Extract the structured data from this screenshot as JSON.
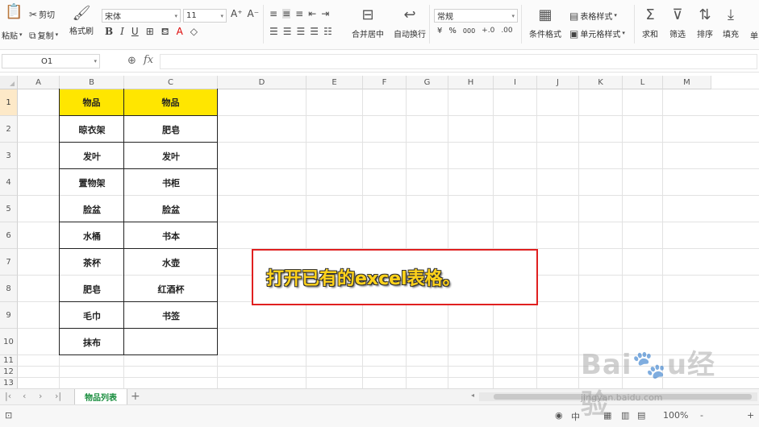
{
  "ribbon": {
    "paste": "粘贴",
    "cut": "剪切",
    "copy": "复制",
    "format_painter": "格式刷",
    "font_name": "宋体",
    "font_size": "11",
    "number_format": "常规",
    "merge_center": "合并居中",
    "wrap_text": "自动换行",
    "currency": "¥",
    "percent": "%",
    "thousands": "000",
    "conditional_format": "条件格式",
    "table_style": "表格样式",
    "cell_style": "单元格样式",
    "sum": "求和",
    "filter": "筛选",
    "sort": "排序",
    "fill": "填充",
    "more": "单"
  },
  "formula_bar": {
    "name_box": "O1",
    "fx": "fx",
    "formula": ""
  },
  "columns": [
    "A",
    "B",
    "C",
    "D",
    "E",
    "F",
    "G",
    "H",
    "I",
    "J",
    "K",
    "L",
    "M"
  ],
  "rows": [
    "1",
    "2",
    "3",
    "4",
    "5",
    "6",
    "7",
    "8",
    "9",
    "10",
    "11",
    "12",
    "13"
  ],
  "table": {
    "header_b": "物品",
    "header_c": "物品",
    "col_b": [
      "晾衣架",
      "发叶",
      "置物架",
      "脸盆",
      "水桶",
      "茶杯",
      "肥皂",
      "毛巾",
      "抹布"
    ],
    "col_c": [
      "肥皂",
      "发叶",
      "书柜",
      "脸盆",
      "书本",
      "水壶",
      "红酒杯",
      "书签",
      ""
    ]
  },
  "annotation": {
    "text": "打开已有的excel表格。"
  },
  "sheet_tabs": {
    "active": "物品列表",
    "add": "+"
  },
  "status": {
    "zoom": "100%",
    "zoom_minus": "-",
    "zoom_plus": "+"
  },
  "watermark": {
    "logo": "Baidu经验",
    "url": "jingyan.baidu.com"
  }
}
